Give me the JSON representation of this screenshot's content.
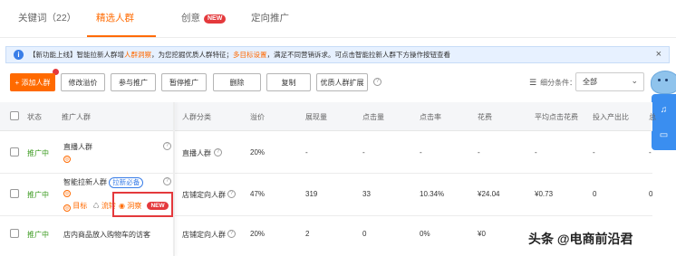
{
  "tabs": [
    {
      "label": "关键词（22）"
    },
    {
      "label": "精选人群"
    },
    {
      "label": "创意",
      "badge": "NEW"
    },
    {
      "label": "定向推广"
    }
  ],
  "notice": {
    "prefix": "【新功能上线】智能拉新人群增",
    "link1": "人群洞察",
    "mid": "，为您挖掘优质人群特征；",
    "link2": "多目标设置",
    "suffix": "，满足不同营销诉求。可点击智能拉新人群下方操作按钮查看",
    "close": "×"
  },
  "toolbar": {
    "add": "+ 添加人群",
    "buttons": [
      "修改溢价",
      "参与推广",
      "暂停推广",
      "删除",
      "复制",
      "优质人群扩展"
    ],
    "help": "?",
    "filter_label": "细分条件：",
    "filter_value": "全部",
    "chevron": "⌄"
  },
  "table": {
    "headers": [
      "状态",
      "推广人群",
      "人群分类",
      "溢价",
      "展现量",
      "点击量",
      "点击率",
      "花费",
      "平均点击花费",
      "投入产出比",
      "总"
    ],
    "rows": [
      {
        "status": "推广中",
        "name": "直播人群",
        "category": "直播人群",
        "premium": "20%",
        "impressions": "-",
        "clicks": "-",
        "ctr": "-",
        "cost": "-",
        "cpc": "-",
        "roi": "-",
        "last": "-"
      },
      {
        "status": "推广中",
        "name": "智能拉新人群",
        "tag": "拉新必备",
        "category": "店铺定向人群",
        "premium": "47%",
        "impressions": "319",
        "clicks": "33",
        "ctr": "10.34%",
        "cost": "¥24.04",
        "cpc": "¥0.73",
        "roi": "0",
        "last": "0",
        "actions": {
          "goal": "目标",
          "flow": "流转",
          "insight": "洞察",
          "insight_badge": "NEW"
        }
      },
      {
        "status": "推广中",
        "name": "店内商品放入购物车的访客",
        "category": "店铺定向人群",
        "premium": "20%",
        "impressions": "2",
        "clicks": "0",
        "ctr": "0%",
        "cost": "¥0",
        "cpc": "",
        "roi": "",
        "last": ""
      }
    ]
  },
  "watermark": "头条 @电商前沿君",
  "colors": {
    "accent": "#ff6a00",
    "status": "#3a9a1e",
    "link": "#3a7ee8",
    "alert": "#e4393c"
  },
  "icons": [
    "info-icon",
    "close-icon",
    "help-icon",
    "list-icon",
    "chevron-down-icon",
    "bell-icon",
    "chat-icon",
    "eye-icon",
    "target-icon",
    "flow-icon",
    "mascot-icon"
  ]
}
